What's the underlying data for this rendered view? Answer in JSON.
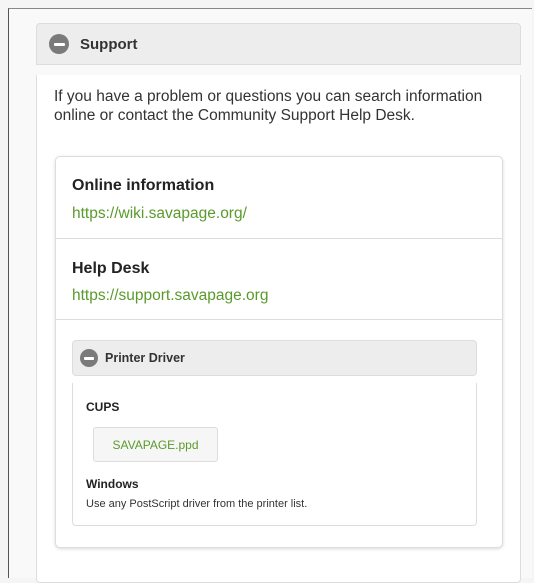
{
  "support": {
    "title": "Support",
    "intro": "If you have a problem or questions you can search information online or contact the Community Support Help Desk.",
    "online": {
      "title": "Online information",
      "link": "https://wiki.savapage.org/"
    },
    "helpdesk": {
      "title": "Help Desk",
      "link": "https://support.savapage.org"
    },
    "printer_driver": {
      "title": "Printer Driver",
      "cups_label": "CUPS",
      "ppd_button": "SAVAPAGE.ppd",
      "windows_label": "Windows",
      "windows_text": "Use any PostScript driver from the printer list."
    }
  },
  "icons": {
    "collapse": "minus-circle-icon"
  },
  "colors": {
    "link": "#5a9a2a",
    "header_bg": "#ededed"
  }
}
